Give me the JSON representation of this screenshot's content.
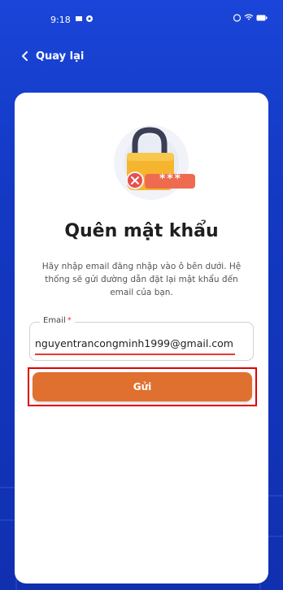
{
  "status_bar": {
    "time": "9:18"
  },
  "nav": {
    "back_label": "Quay lại"
  },
  "card": {
    "title": "Quên mật khẩu",
    "description": "Hãy nhập email đăng nhập vào ô bên dưới. Hệ thống sẽ gửi đường dẫn đặt lại mật khẩu đến email của bạn.",
    "illustration_mask": "***"
  },
  "form": {
    "email_label": "Email",
    "email_required_mark": "*",
    "email_value": "nguyentrancongminh1999@gmail.com",
    "submit_label": "Gửi"
  },
  "colors": {
    "background": "#1338c2",
    "primary_button": "#e07030",
    "highlight_border": "#e00000",
    "error_underline": "#e53935"
  }
}
